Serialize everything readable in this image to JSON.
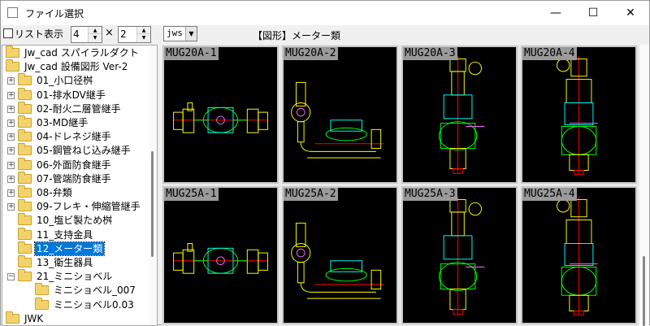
{
  "window": {
    "title": "ファイル選択",
    "minimize": "—",
    "maximize": "☐",
    "close": "✕"
  },
  "toolbar": {
    "list_checkbox_label": "リスト表示",
    "list_checked": false,
    "cols_value": "4",
    "times": "×",
    "rows_value": "2",
    "ext_select": "jws",
    "category_label": "【図形】メーター類"
  },
  "tree": {
    "items": [
      {
        "label": "Jw_cad スパイラルダクト",
        "level": 0,
        "expander": "",
        "selected": false
      },
      {
        "label": "Jw_cad 設備図形 Ver-2",
        "level": 0,
        "expander": "",
        "selected": false
      },
      {
        "label": "01_小口径桝",
        "level": 1,
        "expander": "+",
        "selected": false
      },
      {
        "label": "01-排水DV継手",
        "level": 1,
        "expander": "+",
        "selected": false
      },
      {
        "label": "02-耐火二層管継手",
        "level": 1,
        "expander": "+",
        "selected": false
      },
      {
        "label": "03-MD継手",
        "level": 1,
        "expander": "+",
        "selected": false
      },
      {
        "label": "04-ドレネジ継手",
        "level": 1,
        "expander": "+",
        "selected": false
      },
      {
        "label": "05-鋼管ねじ込み継手",
        "level": 1,
        "expander": "+",
        "selected": false
      },
      {
        "label": "06-外面防食継手",
        "level": 1,
        "expander": "+",
        "selected": false
      },
      {
        "label": "07-管端防食継手",
        "level": 1,
        "expander": "+",
        "selected": false
      },
      {
        "label": "08-弁類",
        "level": 1,
        "expander": "+",
        "selected": false
      },
      {
        "label": "09-フレキ・伸縮管継手",
        "level": 1,
        "expander": "+",
        "selected": false
      },
      {
        "label": "10_塩ビ製ため桝",
        "level": 1,
        "expander": "",
        "selected": false
      },
      {
        "label": "11_支持金具",
        "level": 1,
        "expander": "",
        "selected": false
      },
      {
        "label": "12_メーター類",
        "level": 1,
        "expander": "",
        "selected": true
      },
      {
        "label": "13_衛生器具",
        "level": 1,
        "expander": "",
        "selected": false
      },
      {
        "label": "21_ミニショベル",
        "level": 1,
        "expander": "−",
        "selected": false
      },
      {
        "label": "ミニショベル_007",
        "level": 2,
        "expander": "",
        "selected": false
      },
      {
        "label": "ミニショベル0.03",
        "level": 2,
        "expander": "",
        "selected": false
      },
      {
        "label": "JWK",
        "level": 0,
        "expander": "",
        "selected": false
      }
    ]
  },
  "thumbnails": [
    {
      "label": "MUG20A-1",
      "kind": "horiz"
    },
    {
      "label": "MUG20A-2",
      "kind": "side"
    },
    {
      "label": "MUG20A-3",
      "kind": "vert"
    },
    {
      "label": "MUG20A-4",
      "kind": "vert2"
    },
    {
      "label": "MUG25A-1",
      "kind": "horiz"
    },
    {
      "label": "MUG25A-2",
      "kind": "side"
    },
    {
      "label": "MUG25A-3",
      "kind": "vert"
    },
    {
      "label": "MUG25A-4",
      "kind": "vert2"
    }
  ],
  "colors": {
    "selection": "#0078d7",
    "cad_bg": "#000000",
    "cad_yellow": "#ffff00",
    "cad_green": "#00ff00",
    "cad_cyan": "#00ffff",
    "cad_red": "#ff0000",
    "cad_magenta": "#ff66ff"
  }
}
